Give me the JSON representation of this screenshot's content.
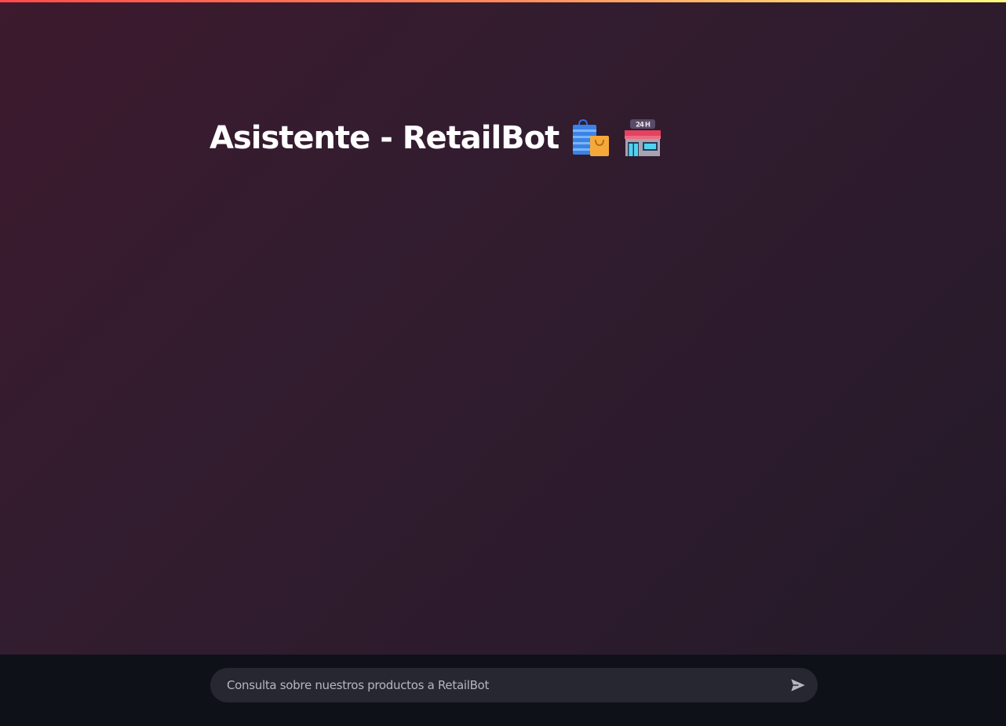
{
  "header": {
    "title": "Asistente - RetailBot",
    "icons": [
      "shopping-bags-icon",
      "convenience-store-icon"
    ],
    "store_sign_text": "24 H"
  },
  "chat": {
    "input_placeholder": "Consulta sobre nuestros productos a RetailBot",
    "input_value": "",
    "send_icon": "send-icon"
  },
  "colors": {
    "background_start": "#3d1a2e",
    "background_end": "#231a28",
    "bottom_bar": "#0f1119",
    "input_background": "#262730",
    "title_text": "#ffffff",
    "placeholder_text": "#b6b6c0",
    "accent_gradient": [
      "#ff4b4b",
      "#fffd80"
    ]
  }
}
